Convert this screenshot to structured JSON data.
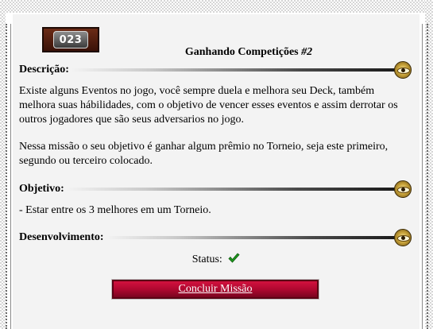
{
  "mission": {
    "number": "023",
    "title": "Ganhando Competições",
    "title_num": "#2"
  },
  "sections": {
    "description": {
      "label": "Descrição:",
      "paragraph1": "Existe alguns Eventos no jogo, você sempre duela e melhora seu Deck, também melhora suas hábilidades, com o objetivo de vencer esses eventos e assim derrotar os outros jogadores que são seus adversarios no jogo.",
      "paragraph2": "Nessa missão o seu objetivo é ganhar algum prêmio no Torneio, seja este primeiro, segundo ou terceiro colocado."
    },
    "objective": {
      "label": "Objetivo:",
      "text": "- Estar entre os 3 melhores em um Torneio."
    },
    "development": {
      "label": "Desenvolvimento:",
      "status_label": "Status:",
      "status_icon": "check-icon"
    }
  },
  "actions": {
    "conclude_label": "Concluir Missão"
  },
  "colors": {
    "button": "#b00830",
    "check": "#1e9a1e",
    "badge": "#4a1a0c"
  }
}
